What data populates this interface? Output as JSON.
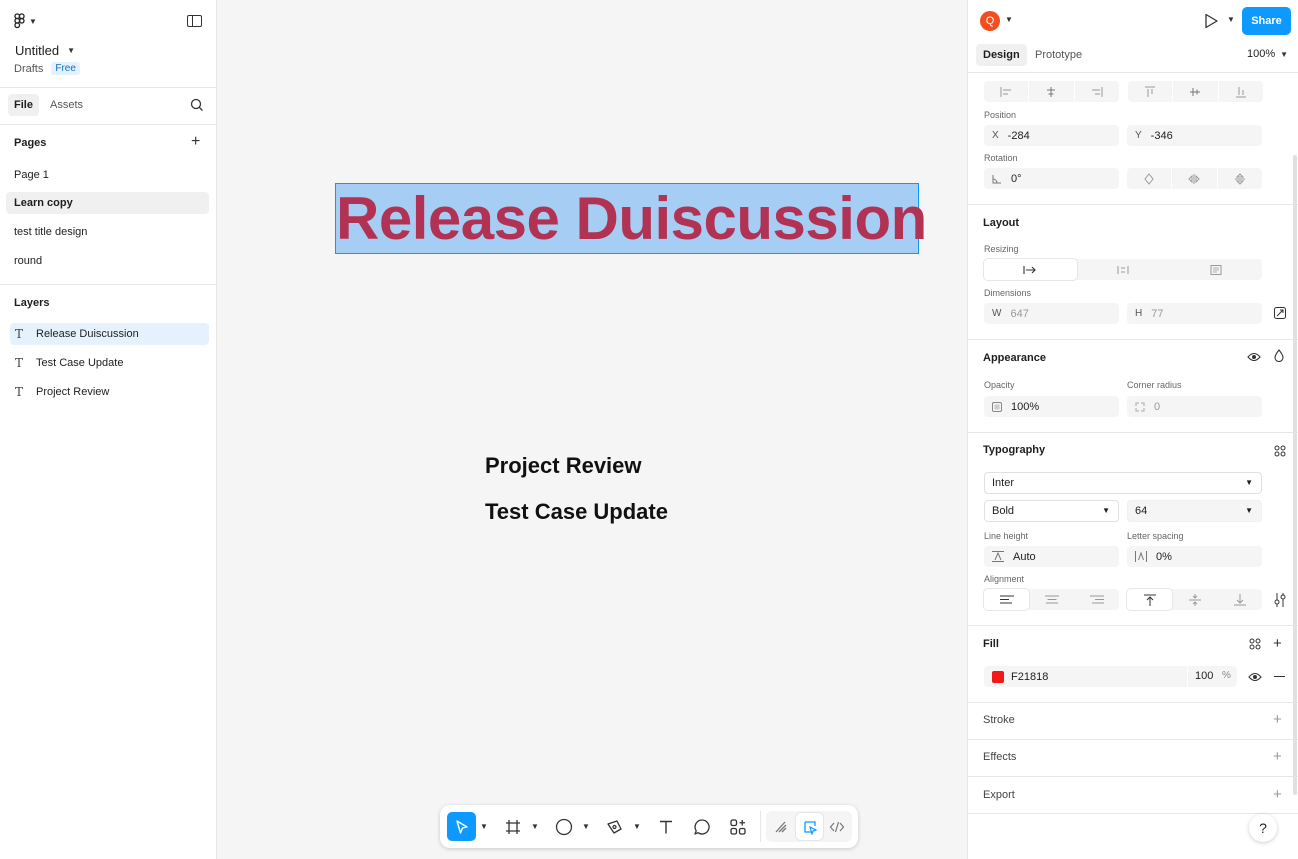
{
  "file": {
    "title": "Untitled",
    "location": "Drafts",
    "plan_badge": "Free"
  },
  "left_tabs": {
    "file": "File",
    "assets": "Assets"
  },
  "pages": {
    "heading": "Pages",
    "items": [
      {
        "label": "Page 1",
        "selected": false
      },
      {
        "label": "Learn copy",
        "selected": true
      },
      {
        "label": "test  title design",
        "selected": false
      },
      {
        "label": "round",
        "selected": false
      }
    ]
  },
  "layers": {
    "heading": "Layers",
    "items": [
      {
        "label": "Release Duiscussion",
        "type": "text",
        "selected": true
      },
      {
        "label": "Test Case Update",
        "type": "text",
        "selected": false
      },
      {
        "label": "Project Review",
        "type": "text",
        "selected": false
      }
    ]
  },
  "canvas": {
    "selected_text": "Release Duiscussion",
    "text_1": "Project Review",
    "text_2": "Test Case Update"
  },
  "header": {
    "avatar_letter": "Q",
    "share_label": "Share"
  },
  "right_tabs": {
    "design": "Design",
    "prototype": "Prototype",
    "zoom": "100%"
  },
  "position": {
    "heading": "Position",
    "x_prefix": "X",
    "x": "-284",
    "y_prefix": "Y",
    "y": "-346"
  },
  "rotation": {
    "heading": "Rotation",
    "value": "0°"
  },
  "layout": {
    "heading": "Layout",
    "resizing_label": "Resizing",
    "dimensions_label": "Dimensions",
    "w_prefix": "W",
    "w": "647",
    "h_prefix": "H",
    "h": "77"
  },
  "appearance": {
    "heading": "Appearance",
    "opacity_label": "Opacity",
    "opacity": "100%",
    "radius_label": "Corner radius",
    "radius": "0"
  },
  "typography": {
    "heading": "Typography",
    "font_family": "Inter",
    "font_weight": "Bold",
    "font_size": "64",
    "line_height_label": "Line height",
    "line_height": "Auto",
    "letter_spacing_label": "Letter spacing",
    "letter_spacing": "0%",
    "alignment_label": "Alignment"
  },
  "fill": {
    "heading": "Fill",
    "hex": "F21818",
    "opacity": "100",
    "unit": "%",
    "color": "#f21818"
  },
  "stroke": {
    "heading": "Stroke"
  },
  "effects": {
    "heading": "Effects"
  },
  "export": {
    "heading": "Export"
  },
  "colors": {
    "accent": "#0d99ff",
    "selected_text": "#b23254",
    "selection_fill": "#a6cdf3"
  }
}
